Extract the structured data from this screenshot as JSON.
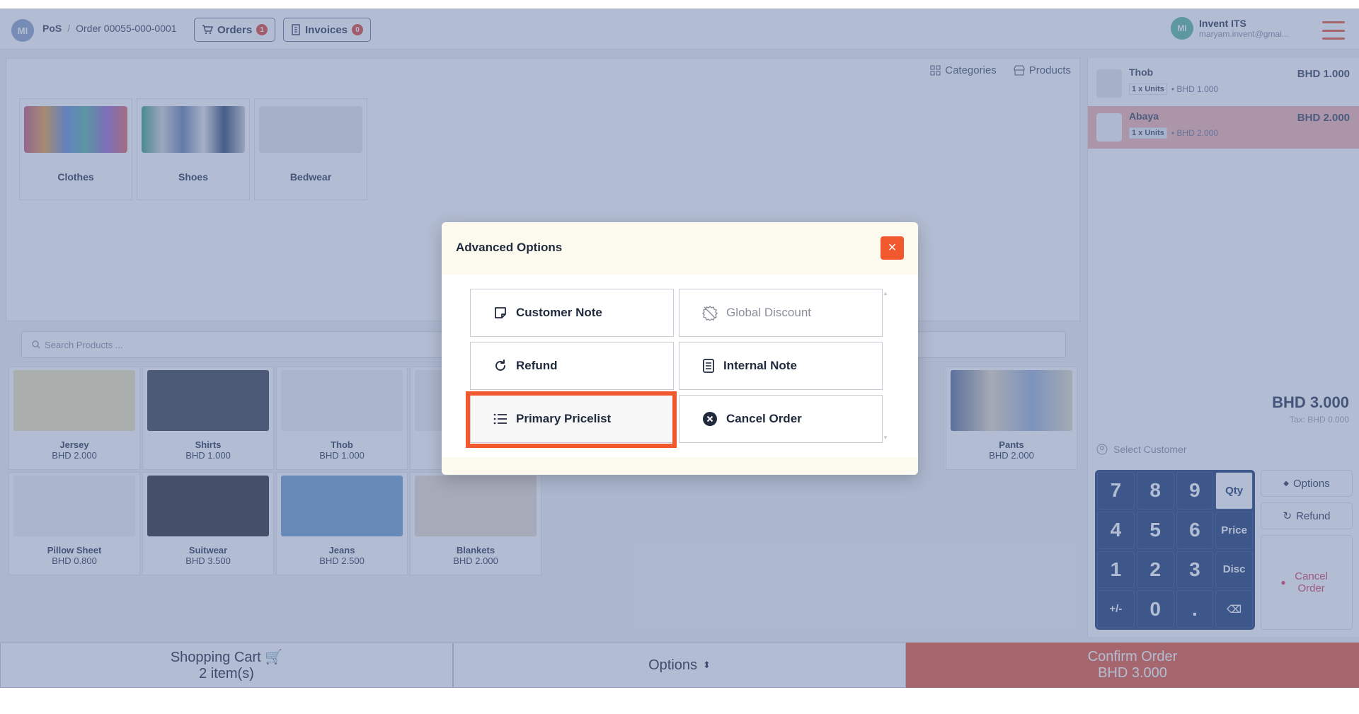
{
  "header": {
    "logo": "MI",
    "crumb_root": "PoS",
    "crumb_sep": "/",
    "crumb_order": "Order 00055-000-0001",
    "orders_label": "Orders",
    "orders_count": "1",
    "invoices_label": "Invoices",
    "invoices_count": "0",
    "user_name": "Invent ITS",
    "user_email": "maryam.invent@gmai..."
  },
  "categories": {
    "tab_categories": "Categories",
    "tab_products": "Products",
    "items": [
      {
        "label": "Clothes"
      },
      {
        "label": "Shoes"
      },
      {
        "label": "Bedwear"
      }
    ]
  },
  "search": {
    "placeholder": "Search Products ..."
  },
  "products": [
    {
      "name": "Jersey",
      "price": "BHD 2.000"
    },
    {
      "name": "Shirts",
      "price": "BHD 1.000"
    },
    {
      "name": "Thob",
      "price": "BHD 1.000"
    },
    {
      "name": "Pants",
      "price": "BHD 2.000"
    },
    {
      "name": "Pillow Sheet",
      "price": "BHD 0.800"
    },
    {
      "name": "Suitwear",
      "price": "BHD 3.500"
    },
    {
      "name": "Jeans",
      "price": "BHD 2.500"
    },
    {
      "name": "Blankets",
      "price": "BHD 2.000"
    }
  ],
  "cart": {
    "lines": [
      {
        "name": "Thob",
        "price": "BHD 1.000",
        "units": "1 x Units",
        "unit_price": "• BHD 1.000"
      },
      {
        "name": "Abaya",
        "price": "BHD 2.000",
        "units": "1 x Units",
        "unit_price": "• BHD 2.000"
      }
    ],
    "total": "BHD 3.000",
    "tax": "Tax: BHD 0.000",
    "customer_placeholder": "Select Customer",
    "keys": [
      "7",
      "8",
      "9",
      "Qty",
      "4",
      "5",
      "6",
      "Price",
      "1",
      "2",
      "3",
      "Disc",
      "+/-",
      "0",
      ".",
      "⌫"
    ],
    "options_label": "Options",
    "refund_label": "Refund",
    "cancel_label": "Cancel Order"
  },
  "footer": {
    "cart_label": "Shopping Cart",
    "cart_count": "2 item(s)",
    "options_label": "Options",
    "confirm_label": "Confirm Order",
    "confirm_total": "BHD 3.000"
  },
  "modal": {
    "title": "Advanced Options",
    "close": "×",
    "options": {
      "customer_note": "Customer Note",
      "global_discount": "Global Discount",
      "refund": "Refund",
      "internal_note": "Internal Note",
      "primary_pricelist": "Primary Pricelist",
      "cancel_order": "Cancel Order"
    }
  },
  "colors": {
    "accent": "#f1582e",
    "numpad": "#1f3e78",
    "selected_line": "#f4b4b0"
  }
}
